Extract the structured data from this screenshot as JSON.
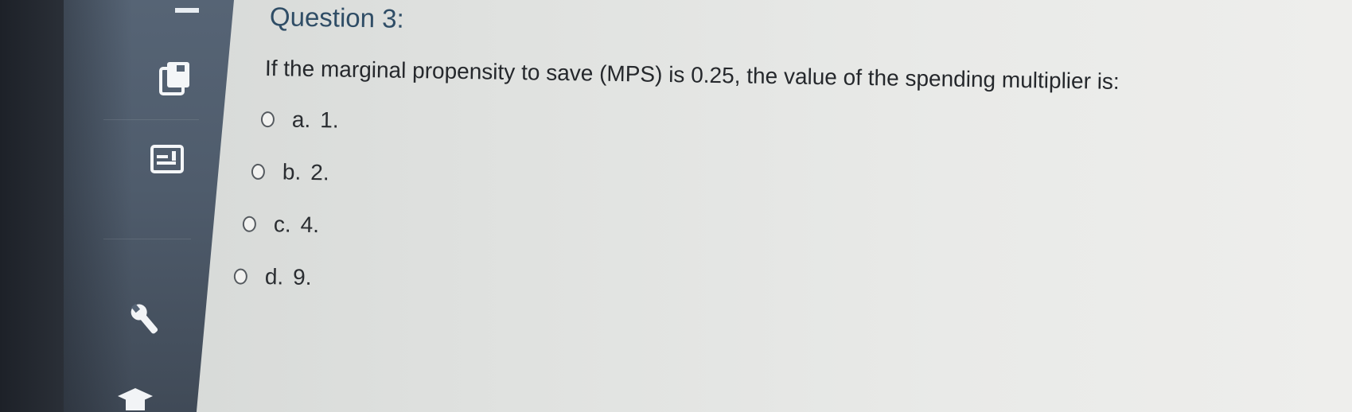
{
  "sidebar": {
    "icons": [
      {
        "name": "layers-icon"
      },
      {
        "name": "gradebook-icon"
      },
      {
        "name": "wrench-icon"
      },
      {
        "name": "graduation-cap-icon"
      }
    ]
  },
  "question": {
    "title": "Question 3:",
    "text": "If the marginal propensity to save (MPS) is 0.25, the value of the spending multiplier is:",
    "options": [
      {
        "letter": "a.",
        "value": "1."
      },
      {
        "letter": "b.",
        "value": "2."
      },
      {
        "letter": "c.",
        "value": "4."
      },
      {
        "letter": "d.",
        "value": "9."
      }
    ]
  },
  "colors": {
    "sidebar": "#566475",
    "title": "#2f4d66",
    "text": "#25282c",
    "background": "#e6e7e5"
  }
}
